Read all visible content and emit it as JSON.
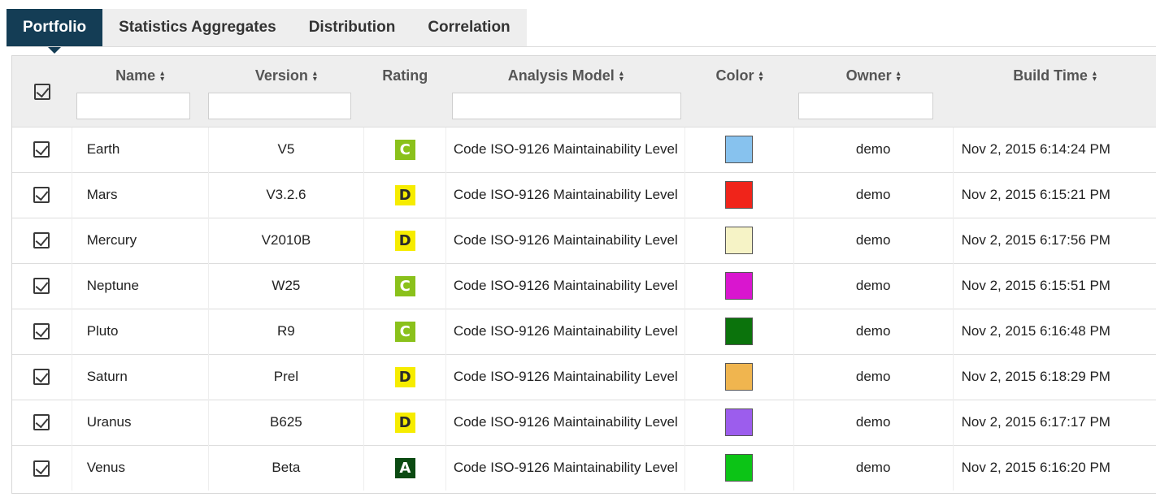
{
  "tabs": [
    {
      "label": "Portfolio",
      "active": true
    },
    {
      "label": "Statistics Aggregates",
      "active": false
    },
    {
      "label": "Distribution",
      "active": false
    },
    {
      "label": "Correlation",
      "active": false
    }
  ],
  "table": {
    "columns": [
      {
        "label": "",
        "sortable": false,
        "filter": false
      },
      {
        "label": "Name",
        "sortable": true,
        "filter": true,
        "filter_value": "",
        "filter_placeholder": ""
      },
      {
        "label": "Version",
        "sortable": true,
        "filter": true,
        "filter_value": "",
        "filter_placeholder": ""
      },
      {
        "label": "Rating",
        "sortable": false,
        "filter": false
      },
      {
        "label": "Analysis Model",
        "sortable": true,
        "filter": true,
        "filter_value": "",
        "filter_placeholder": ""
      },
      {
        "label": "Color",
        "sortable": true,
        "filter": false
      },
      {
        "label": "Owner",
        "sortable": true,
        "filter": true,
        "filter_value": "",
        "filter_placeholder": ""
      },
      {
        "label": "Build Time",
        "sortable": true,
        "filter": false
      }
    ],
    "sort_icon": "sort-updown-icon",
    "select_all_checked": true,
    "rows": [
      {
        "checked": true,
        "name": "Earth",
        "version": "V5",
        "rating": "C",
        "model": "Code ISO-9126 Maintainability Level",
        "color": "#87c2ee",
        "owner": "demo",
        "build_time": "Nov 2, 2015 6:14:24 PM"
      },
      {
        "checked": true,
        "name": "Mars",
        "version": "V3.2.6",
        "rating": "D",
        "model": "Code ISO-9126 Maintainability Level",
        "color": "#f0241a",
        "owner": "demo",
        "build_time": "Nov 2, 2015 6:15:21 PM"
      },
      {
        "checked": true,
        "name": "Mercury",
        "version": "V2010B",
        "rating": "D",
        "model": "Code ISO-9126 Maintainability Level",
        "color": "#f6f3c6",
        "owner": "demo",
        "build_time": "Nov 2, 2015 6:17:56 PM"
      },
      {
        "checked": true,
        "name": "Neptune",
        "version": "W25",
        "rating": "C",
        "model": "Code ISO-9126 Maintainability Level",
        "color": "#d916cf",
        "owner": "demo",
        "build_time": "Nov 2, 2015 6:15:51 PM"
      },
      {
        "checked": true,
        "name": "Pluto",
        "version": "R9",
        "rating": "C",
        "model": "Code ISO-9126 Maintainability Level",
        "color": "#0b730c",
        "owner": "demo",
        "build_time": "Nov 2, 2015 6:16:48 PM"
      },
      {
        "checked": true,
        "name": "Saturn",
        "version": "Prel",
        "rating": "D",
        "model": "Code ISO-9126 Maintainability Level",
        "color": "#f0b54f",
        "owner": "demo",
        "build_time": "Nov 2, 2015 6:18:29 PM"
      },
      {
        "checked": true,
        "name": "Uranus",
        "version": "B625",
        "rating": "D",
        "model": "Code ISO-9126 Maintainability Level",
        "color": "#9c5ded",
        "owner": "demo",
        "build_time": "Nov 2, 2015 6:17:17 PM"
      },
      {
        "checked": true,
        "name": "Venus",
        "version": "Beta",
        "rating": "A",
        "model": "Code ISO-9126 Maintainability Level",
        "color": "#0cc416",
        "owner": "demo",
        "build_time": "Nov 2, 2015 6:16:20 PM"
      }
    ]
  },
  "rating_colors": {
    "A": {
      "bg": "#0b4a12",
      "fg": "#ffffff"
    },
    "C": {
      "bg": "#8ac11b",
      "fg": "#ffffff"
    },
    "D": {
      "bg": "#f6ec00",
      "fg": "#2b2b2b"
    }
  }
}
